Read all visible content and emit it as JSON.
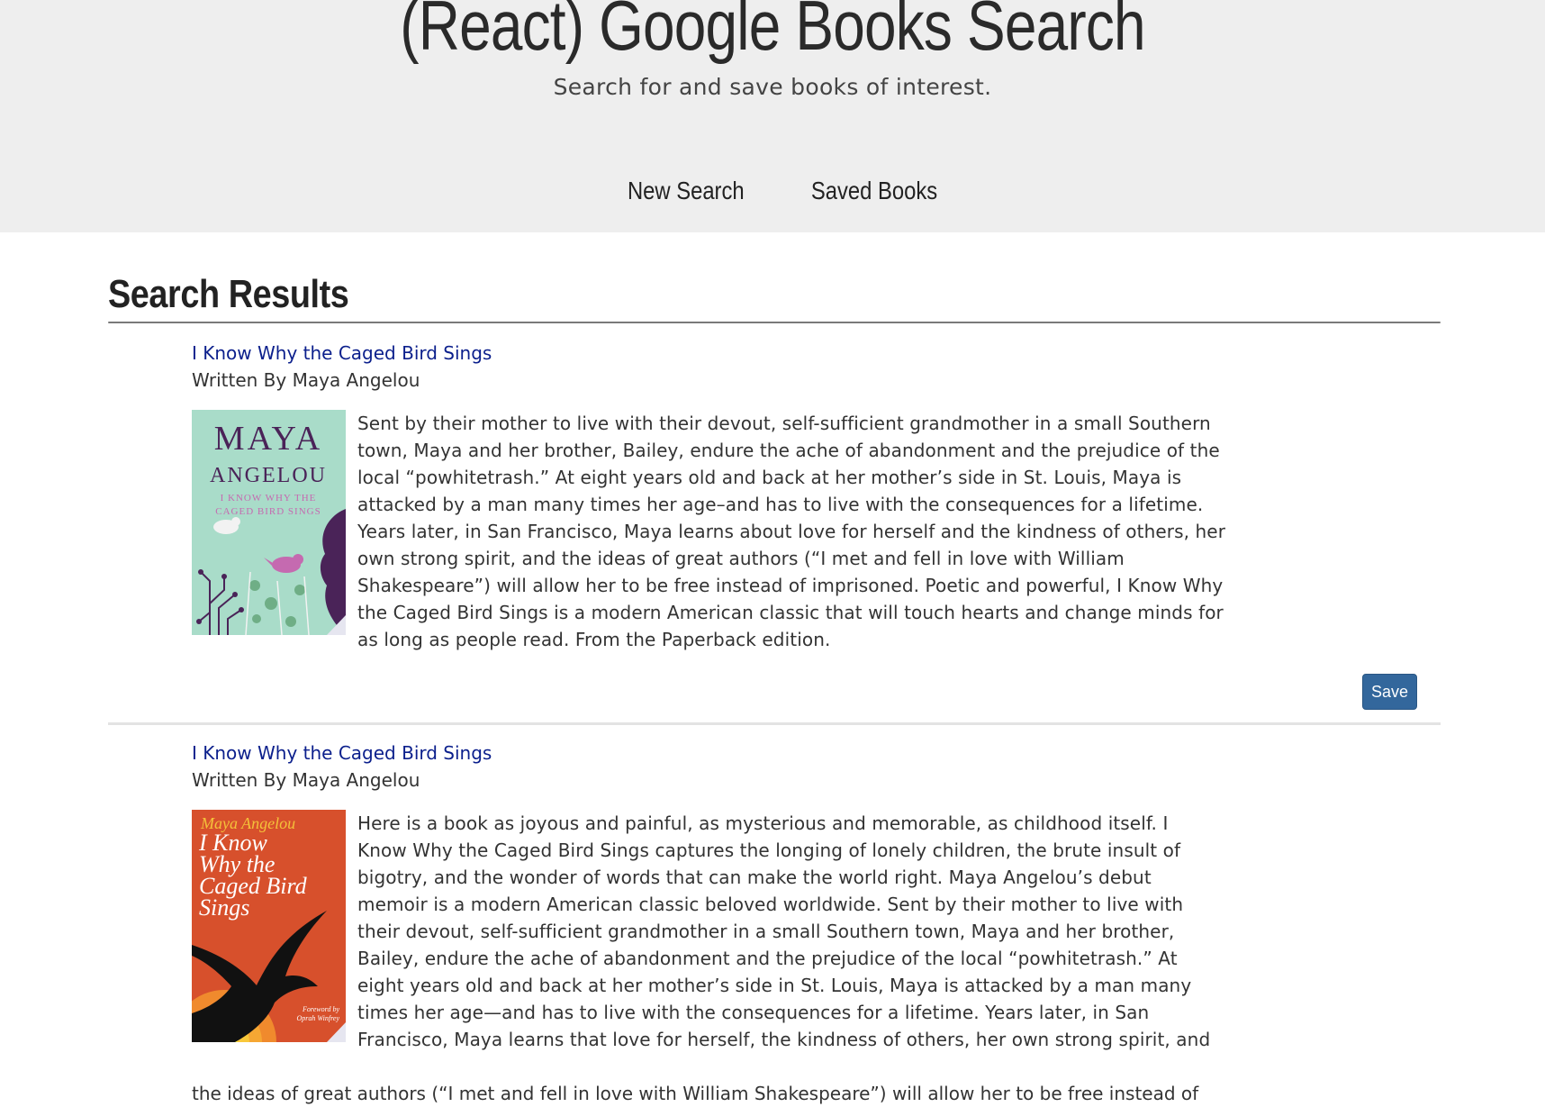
{
  "header": {
    "title": "(React) Google Books Search",
    "subtitle": "Search for and save books of interest."
  },
  "nav": {
    "items": [
      {
        "label": "New Search"
      },
      {
        "label": "Saved Books"
      }
    ]
  },
  "results": {
    "heading": "Search Results",
    "books": [
      {
        "title": "I Know Why the Caged Bird Sings",
        "author_line": "Written By Maya Angelou",
        "cover": {
          "author_text": "MAYA",
          "author_text_2": "ANGELOU",
          "subtitle_text": "I KNOW WHY THE",
          "subtitle_text_2": "CAGED BIRD SINGS",
          "bg_color": "#a9dcc9",
          "text_color": "#4a2358",
          "accent_color": "#c56ab0"
        },
        "description": "Sent by their mother to live with their devout, self-sufficient grandmother in a small Southern town, Maya and her brother, Bailey, endure the ache of abandonment and the prejudice of the local “powhitetrash.” At eight years old and back at her mother’s side in St. Louis, Maya is attacked by a man many times her age–and has to live with the consequences for a lifetime. Years later, in San Francisco, Maya learns about love for herself and the kindness of others, her own strong spirit, and the ideas of great authors (“I met and fell in love with William Shakespeare”) will allow her to be free instead of imprisoned. Poetic and powerful, I Know Why the Caged Bird Sings is a modern American classic that will touch hearts and change minds for as long as people read. From the Paperback edition.",
        "save_label": "Save"
      },
      {
        "title": "I Know Why the Caged Bird Sings",
        "author_line": "Written By Maya Angelou",
        "cover": {
          "author_text": "Maya Angelou",
          "title_line_1": "I Know",
          "title_line_2": "Why the",
          "title_line_3": "Caged Bird",
          "title_line_4": "Sings",
          "foreword_line_1": "Foreword by",
          "foreword_line_2": "Oprah Winfrey",
          "bg_color": "#d7502c",
          "author_color": "#f4c13a"
        },
        "description_lines": [
          "Here is a book as joyous and painful, as mysterious and memorable, as childhood itself. I",
          "Know Why the Caged Bird Sings captures the longing of lonely children, the brute insult of",
          "bigotry, and the wonder of words that can make the world right. Maya Angelou’s debut",
          "memoir is a modern American classic beloved worldwide. Sent by their mother to live with",
          "their devout, self-sufficient grandmother in a small Southern town, Maya and her brother,",
          "Bailey, endure the ache of abandonment and the prejudice of the local “powhitetrash.” At",
          "eight years old and back at her mother’s side in St. Louis, Maya is attacked by a man many",
          "times her age—and has to live with the consequences for a lifetime. Years later, in San",
          "Francisco, Maya learns that love for herself, the kindness of others, her own strong spirit, and",
          "the ideas of great authors (“I met and fell in love with William Shakespeare”) will allow her to be free instead of"
        ]
      }
    ]
  }
}
